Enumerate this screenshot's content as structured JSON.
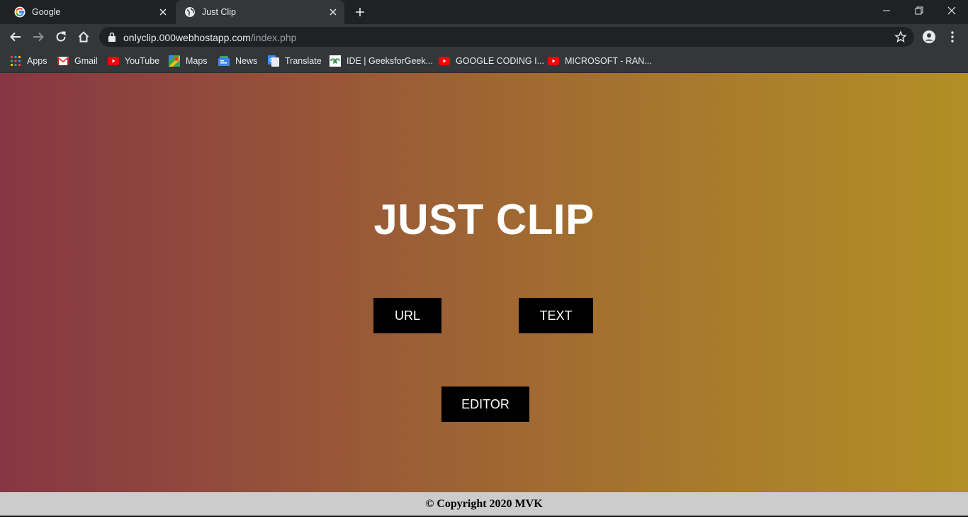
{
  "browser": {
    "tabs": [
      {
        "title": "Google",
        "icon": "google-icon"
      },
      {
        "title": "Just Clip",
        "icon": "globe-icon"
      }
    ],
    "url": {
      "host": "onlyclip.000webhostapp.com",
      "path": "/index.php"
    },
    "bookmarks": [
      {
        "label": "Apps",
        "icon": "apps-grid-icon"
      },
      {
        "label": "Gmail",
        "icon": "gmail-icon"
      },
      {
        "label": "YouTube",
        "icon": "youtube-icon"
      },
      {
        "label": "Maps",
        "icon": "maps-icon"
      },
      {
        "label": "News",
        "icon": "news-icon"
      },
      {
        "label": "Translate",
        "icon": "translate-icon"
      },
      {
        "label": "IDE | GeeksforGeek...",
        "icon": "geeksforgeeks-icon"
      },
      {
        "label": "GOOGLE CODING I...",
        "icon": "youtube-icon"
      },
      {
        "label": "MICROSOFT - RAN...",
        "icon": "youtube-icon"
      }
    ]
  },
  "page": {
    "title": "JUST CLIP",
    "buttons": {
      "url": "URL",
      "text": "TEXT",
      "editor": "EDITOR"
    },
    "footer": "© Copyright 2020 MVK"
  },
  "colors": {
    "gradient_start": "#873643",
    "gradient_end": "#b28f25",
    "button_bg": "#000000",
    "footer_bg": "#cccccc"
  }
}
